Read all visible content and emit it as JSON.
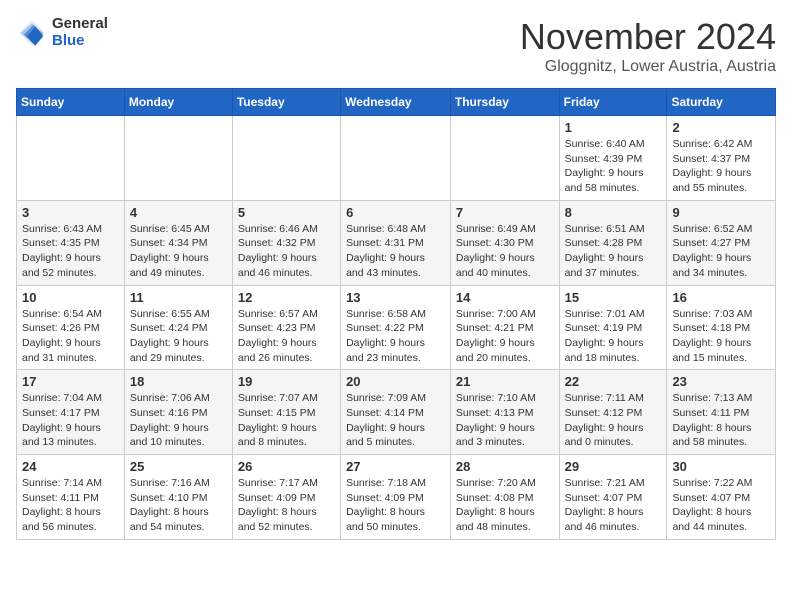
{
  "logo": {
    "general": "General",
    "blue": "Blue"
  },
  "header": {
    "month": "November 2024",
    "location": "Gloggnitz, Lower Austria, Austria"
  },
  "days_of_week": [
    "Sunday",
    "Monday",
    "Tuesday",
    "Wednesday",
    "Thursday",
    "Friday",
    "Saturday"
  ],
  "weeks": [
    [
      {
        "day": "",
        "info": ""
      },
      {
        "day": "",
        "info": ""
      },
      {
        "day": "",
        "info": ""
      },
      {
        "day": "",
        "info": ""
      },
      {
        "day": "",
        "info": ""
      },
      {
        "day": "1",
        "info": "Sunrise: 6:40 AM\nSunset: 4:39 PM\nDaylight: 9 hours\nand 58 minutes."
      },
      {
        "day": "2",
        "info": "Sunrise: 6:42 AM\nSunset: 4:37 PM\nDaylight: 9 hours\nand 55 minutes."
      }
    ],
    [
      {
        "day": "3",
        "info": "Sunrise: 6:43 AM\nSunset: 4:35 PM\nDaylight: 9 hours\nand 52 minutes."
      },
      {
        "day": "4",
        "info": "Sunrise: 6:45 AM\nSunset: 4:34 PM\nDaylight: 9 hours\nand 49 minutes."
      },
      {
        "day": "5",
        "info": "Sunrise: 6:46 AM\nSunset: 4:32 PM\nDaylight: 9 hours\nand 46 minutes."
      },
      {
        "day": "6",
        "info": "Sunrise: 6:48 AM\nSunset: 4:31 PM\nDaylight: 9 hours\nand 43 minutes."
      },
      {
        "day": "7",
        "info": "Sunrise: 6:49 AM\nSunset: 4:30 PM\nDaylight: 9 hours\nand 40 minutes."
      },
      {
        "day": "8",
        "info": "Sunrise: 6:51 AM\nSunset: 4:28 PM\nDaylight: 9 hours\nand 37 minutes."
      },
      {
        "day": "9",
        "info": "Sunrise: 6:52 AM\nSunset: 4:27 PM\nDaylight: 9 hours\nand 34 minutes."
      }
    ],
    [
      {
        "day": "10",
        "info": "Sunrise: 6:54 AM\nSunset: 4:26 PM\nDaylight: 9 hours\nand 31 minutes."
      },
      {
        "day": "11",
        "info": "Sunrise: 6:55 AM\nSunset: 4:24 PM\nDaylight: 9 hours\nand 29 minutes."
      },
      {
        "day": "12",
        "info": "Sunrise: 6:57 AM\nSunset: 4:23 PM\nDaylight: 9 hours\nand 26 minutes."
      },
      {
        "day": "13",
        "info": "Sunrise: 6:58 AM\nSunset: 4:22 PM\nDaylight: 9 hours\nand 23 minutes."
      },
      {
        "day": "14",
        "info": "Sunrise: 7:00 AM\nSunset: 4:21 PM\nDaylight: 9 hours\nand 20 minutes."
      },
      {
        "day": "15",
        "info": "Sunrise: 7:01 AM\nSunset: 4:19 PM\nDaylight: 9 hours\nand 18 minutes."
      },
      {
        "day": "16",
        "info": "Sunrise: 7:03 AM\nSunset: 4:18 PM\nDaylight: 9 hours\nand 15 minutes."
      }
    ],
    [
      {
        "day": "17",
        "info": "Sunrise: 7:04 AM\nSunset: 4:17 PM\nDaylight: 9 hours\nand 13 minutes."
      },
      {
        "day": "18",
        "info": "Sunrise: 7:06 AM\nSunset: 4:16 PM\nDaylight: 9 hours\nand 10 minutes."
      },
      {
        "day": "19",
        "info": "Sunrise: 7:07 AM\nSunset: 4:15 PM\nDaylight: 9 hours\nand 8 minutes."
      },
      {
        "day": "20",
        "info": "Sunrise: 7:09 AM\nSunset: 4:14 PM\nDaylight: 9 hours\nand 5 minutes."
      },
      {
        "day": "21",
        "info": "Sunrise: 7:10 AM\nSunset: 4:13 PM\nDaylight: 9 hours\nand 3 minutes."
      },
      {
        "day": "22",
        "info": "Sunrise: 7:11 AM\nSunset: 4:12 PM\nDaylight: 9 hours\nand 0 minutes."
      },
      {
        "day": "23",
        "info": "Sunrise: 7:13 AM\nSunset: 4:11 PM\nDaylight: 8 hours\nand 58 minutes."
      }
    ],
    [
      {
        "day": "24",
        "info": "Sunrise: 7:14 AM\nSunset: 4:11 PM\nDaylight: 8 hours\nand 56 minutes."
      },
      {
        "day": "25",
        "info": "Sunrise: 7:16 AM\nSunset: 4:10 PM\nDaylight: 8 hours\nand 54 minutes."
      },
      {
        "day": "26",
        "info": "Sunrise: 7:17 AM\nSunset: 4:09 PM\nDaylight: 8 hours\nand 52 minutes."
      },
      {
        "day": "27",
        "info": "Sunrise: 7:18 AM\nSunset: 4:09 PM\nDaylight: 8 hours\nand 50 minutes."
      },
      {
        "day": "28",
        "info": "Sunrise: 7:20 AM\nSunset: 4:08 PM\nDaylight: 8 hours\nand 48 minutes."
      },
      {
        "day": "29",
        "info": "Sunrise: 7:21 AM\nSunset: 4:07 PM\nDaylight: 8 hours\nand 46 minutes."
      },
      {
        "day": "30",
        "info": "Sunrise: 7:22 AM\nSunset: 4:07 PM\nDaylight: 8 hours\nand 44 minutes."
      }
    ]
  ]
}
